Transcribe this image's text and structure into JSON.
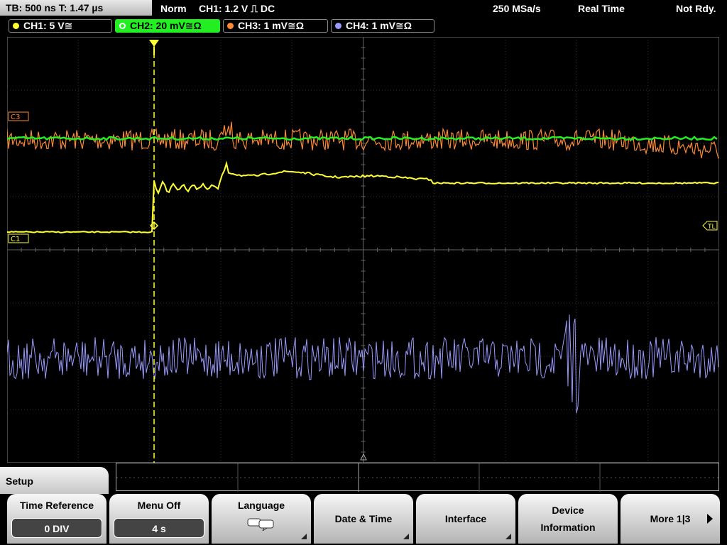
{
  "header": {
    "timebase": "TB: 500 ns   T: 1.47 µs",
    "mode": "Norm",
    "trigger": "CH1: 1.2 V ⎍ DC",
    "sample_rate": "250 MSa/s",
    "acq": "Real Time",
    "state": "Not Rdy."
  },
  "channels": [
    {
      "label": "CH1: 5 V≅",
      "color": "#ffff33"
    },
    {
      "label": "CH2: 20 mV≅Ω",
      "color": "#22ee22"
    },
    {
      "label": "CH3: 1 mV≅Ω",
      "color": "#ff8833"
    },
    {
      "label": "CH4: 1 mV≅Ω",
      "color": "#9999ff"
    }
  ],
  "markers": {
    "c3": "C3",
    "c1": "C1",
    "tl": "TL"
  },
  "menu": {
    "title": "Setup",
    "time_reference_label": "Time Reference",
    "time_reference_value": "0 DIV",
    "menu_off_label": "Menu Off",
    "menu_off_value": "4 s",
    "language_label": "Language",
    "date_time_label": "Date & Time",
    "interface_label": "Interface",
    "device_info_line1": "Device",
    "device_info_line2": "Information",
    "more_label": "More 1|3"
  }
}
